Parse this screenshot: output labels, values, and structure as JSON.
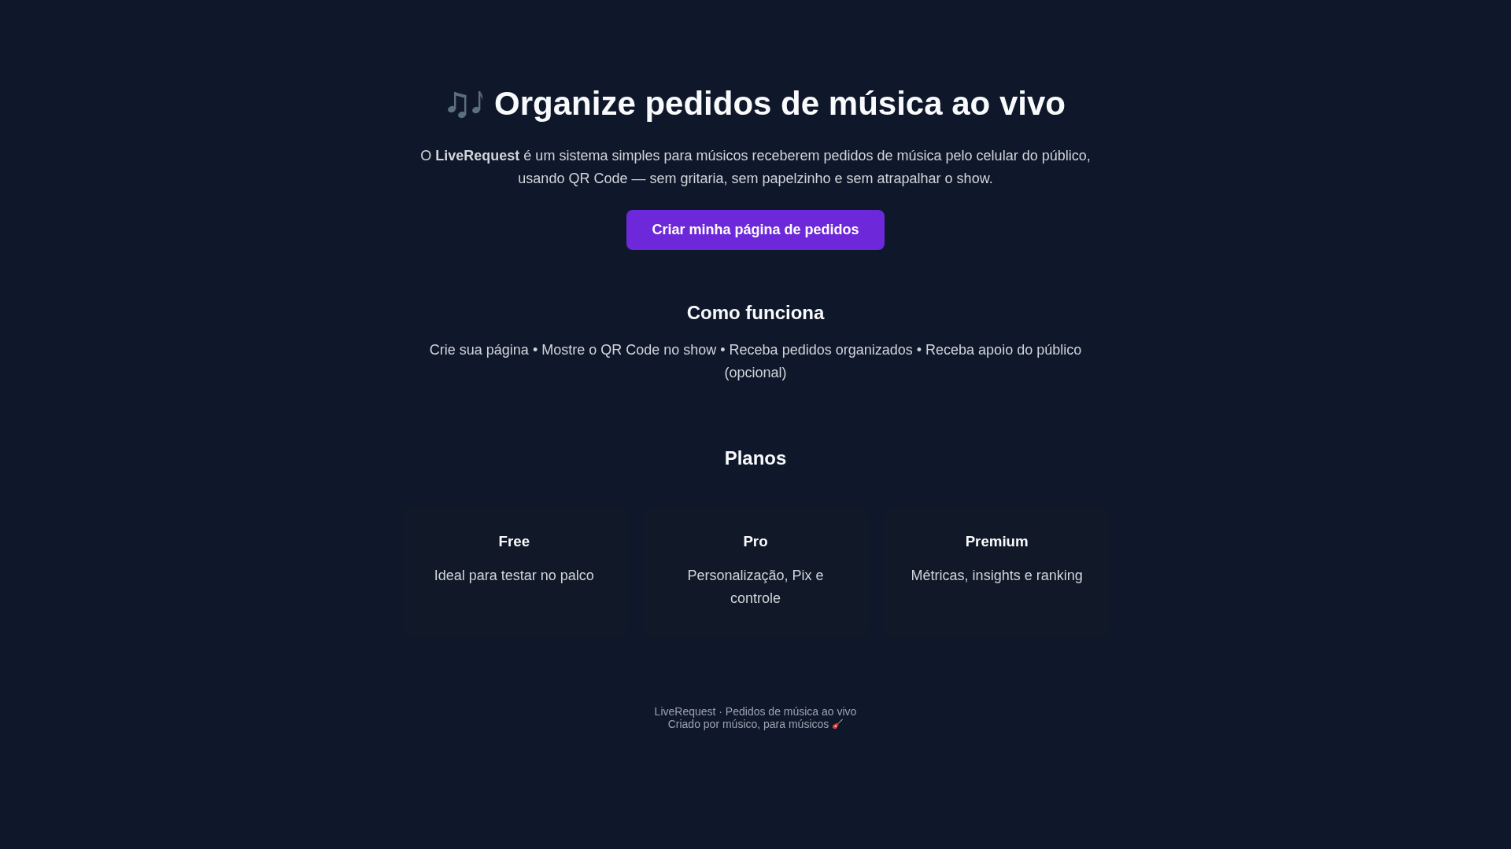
{
  "hero": {
    "title": "Organize pedidos de música ao vivo",
    "description": "O **LiveRequest** é um sistema simples para músicos receberem pedidos de música pelo celular do público, usando QR Code — sem gritaria, sem papelzinho e sem atrapalhar o show.",
    "cta_button": "Criar minha página de pedidos"
  },
  "how_it_works": {
    "heading": "Como funciona",
    "text": "Crie sua página • Mostre o QR Code no show • Receba pedidos organizados • Receba apoio do público (opcional)"
  },
  "plans": {
    "heading": "Planos",
    "items": [
      {
        "name": "Free",
        "description": "Ideal para testar no palco"
      },
      {
        "name": "Pro",
        "description": "Personalização, Pix e controle"
      },
      {
        "name": "Premium",
        "description": "Métricas, insights e ranking"
      }
    ]
  },
  "footer": {
    "lines": [
      "LiveRequest · Pedidos de música ao vivo",
      "Criado por músico, para músicos"
    ]
  }
}
